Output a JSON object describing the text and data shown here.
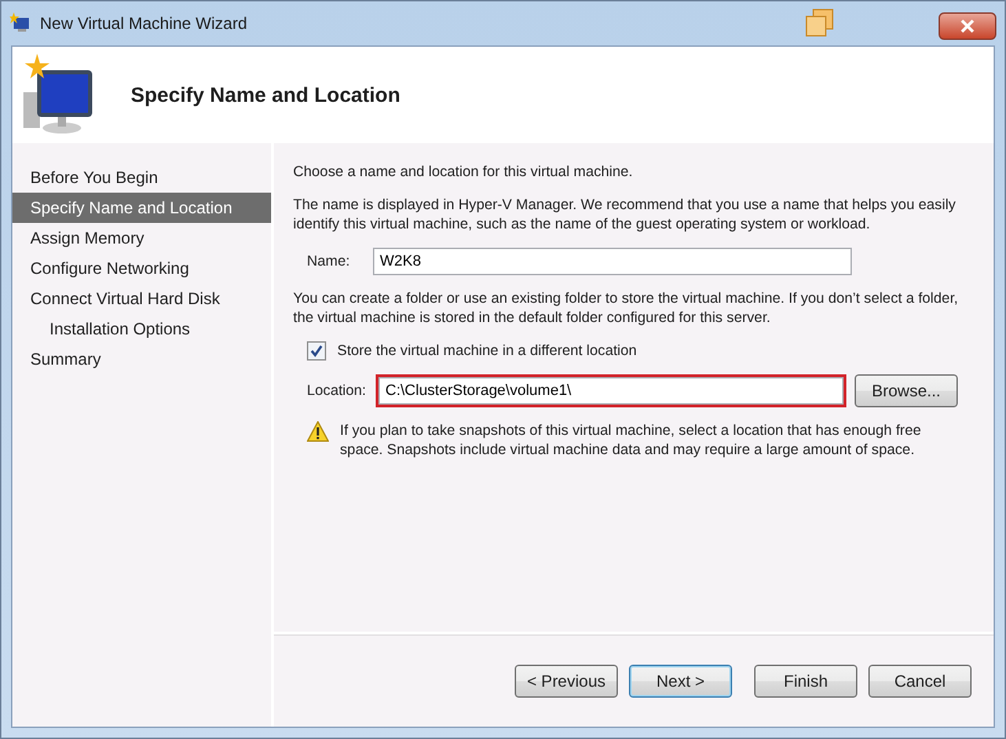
{
  "window": {
    "title": "New Virtual Machine Wizard"
  },
  "header": {
    "title": "Specify Name and Location"
  },
  "steps": [
    {
      "label": "Before You Begin",
      "selected": false
    },
    {
      "label": "Specify Name and Location",
      "selected": true
    },
    {
      "label": "Assign Memory",
      "selected": false
    },
    {
      "label": "Configure Networking",
      "selected": false
    },
    {
      "label": "Connect Virtual Hard Disk",
      "selected": false,
      "children": [
        {
          "label": "Installation Options",
          "selected": false
        }
      ]
    },
    {
      "label": "Summary",
      "selected": false
    }
  ],
  "content": {
    "intro": "Choose a name and location for this virtual machine.",
    "name_help": "The name is displayed in Hyper-V Manager. We recommend that you use a name that helps you easily identify this virtual machine, such as the name of the guest operating system or workload.",
    "name_label": "Name:",
    "name_value": "W2K8",
    "folder_help": "You can create a folder or use an existing folder to store the virtual machine. If you don’t select a folder, the virtual machine is stored in the default folder configured for this server.",
    "store_checkbox": {
      "label": "Store the virtual machine in a different location",
      "checked": true
    },
    "location_label": "Location:",
    "location_value": "C:\\ClusterStorage\\volume1\\",
    "location_highlighted": true,
    "browse_button": "Browse...",
    "warning": "If you plan to take snapshots of this virtual machine, select a location that has enough free space. Snapshots include virtual machine data and may require a large amount of space."
  },
  "buttons": [
    {
      "label": "< Previous",
      "selected": false
    },
    {
      "label": "Next >",
      "selected": true
    },
    {
      "label": "Finish",
      "selected": false
    },
    {
      "label": "Cancel",
      "selected": false
    }
  ]
}
